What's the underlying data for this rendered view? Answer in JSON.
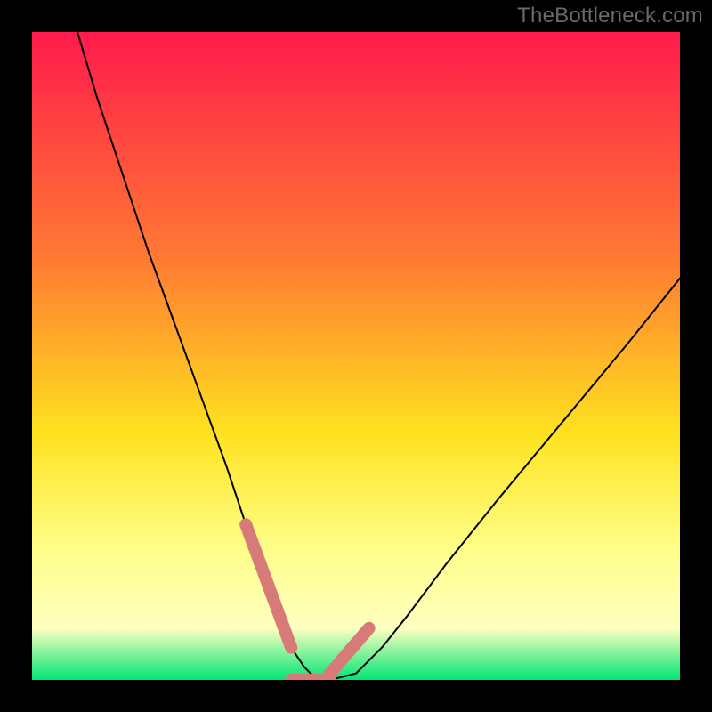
{
  "watermark": "TheBottleneck.com",
  "colors": {
    "frame_bg": "#000000",
    "gradient_top": "#ff1a4b",
    "gradient_mid_upper": "#ff7a33",
    "gradient_mid": "#ffe21f",
    "gradient_lower": "#ffff8a",
    "gradient_bottom": "#00e676",
    "curve_stroke": "#000000",
    "marker_stroke": "#d87a78",
    "watermark_color": "#6a6a6a"
  },
  "chart_data": {
    "type": "line",
    "title": "",
    "xlabel": "",
    "ylabel": "",
    "xlim": [
      0,
      100
    ],
    "ylim": [
      0,
      100
    ],
    "series": [
      {
        "name": "bottleneck-curve",
        "x": [
          7,
          10,
          14,
          18,
          22,
          26,
          30,
          33,
          36,
          38,
          40,
          42,
          44,
          46,
          50,
          54,
          58,
          64,
          72,
          82,
          92,
          100
        ],
        "values": [
          100,
          90,
          78,
          66,
          55,
          44,
          33,
          24,
          16,
          10,
          5,
          2,
          0,
          0,
          1,
          5,
          10,
          18,
          28,
          40,
          52,
          62
        ]
      }
    ],
    "markers": {
      "left_segment": {
        "x": [
          33,
          40
        ],
        "values": [
          24,
          5
        ]
      },
      "bottom_segment": {
        "x": [
          40,
          46
        ],
        "values": [
          0,
          0
        ]
      },
      "right_segment": {
        "x": [
          46,
          52
        ],
        "values": [
          1,
          8
        ]
      }
    },
    "gradient_stops_pct": [
      0,
      35,
      62,
      80,
      92,
      100
    ]
  }
}
